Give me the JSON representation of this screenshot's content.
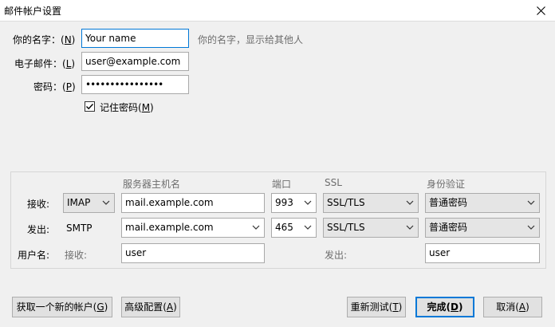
{
  "window": {
    "title": "邮件帐户设置"
  },
  "form": {
    "name_label_pre": "你的名字：(",
    "name_key": "N",
    "name_label_post": ")",
    "name_value": "Your name",
    "name_hint": "你的名字，显示给其他人",
    "email_label_pre": "电子邮件：(",
    "email_key": "L",
    "email_label_post": ")",
    "email_value": "user@example.com",
    "password_label_pre": "密码：(",
    "password_key": "P",
    "password_label_post": ")",
    "password_value": "••••••••••••••••",
    "remember_label_pre": "记住密码(",
    "remember_key": "M",
    "remember_label_post": ")",
    "remember_checked": true
  },
  "server": {
    "col_host": "服务器主机名",
    "col_port": "端口",
    "col_ssl": "SSL",
    "col_auth": "身份验证",
    "incoming": {
      "label": "接收:",
      "protocol": "IMAP",
      "host": "mail.example.com",
      "port": "993",
      "ssl": "SSL/TLS",
      "auth": "普通密码"
    },
    "outgoing": {
      "label": "发出:",
      "protocol": "SMTP",
      "host": "mail.example.com",
      "port": "465",
      "ssl": "SSL/TLS",
      "auth": "普通密码"
    },
    "username": {
      "label": "用户名:",
      "incoming_label": "接收:",
      "incoming_value": "user",
      "outgoing_label": "发出:",
      "outgoing_value": "user"
    }
  },
  "buttons": {
    "new_account_pre": "获取一个新的帐户(",
    "new_account_key": "G",
    "new_account_post": ")",
    "advanced_pre": "高级配置(",
    "advanced_key": "A",
    "advanced_post": ")",
    "retest_pre": "重新测试(",
    "retest_key": "T",
    "retest_post": ")",
    "done_pre": "完成(",
    "done_key": "D",
    "done_post": ")",
    "cancel_pre": "取消(",
    "cancel_key": "A",
    "cancel_post": ")"
  }
}
